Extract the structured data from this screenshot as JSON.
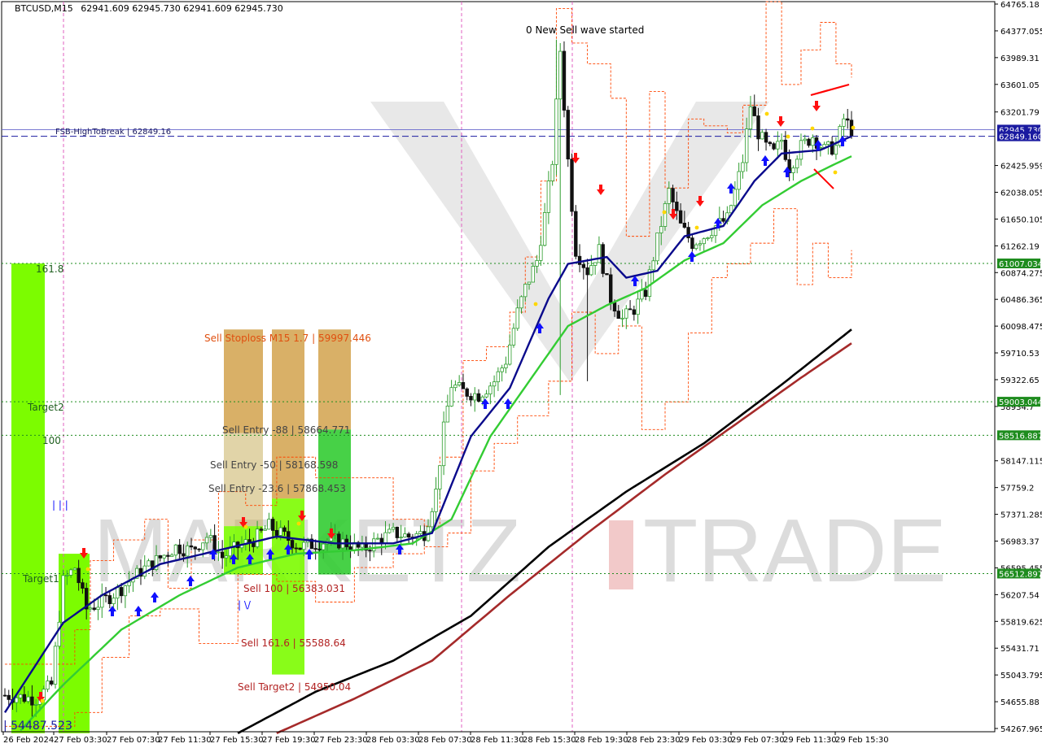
{
  "header": {
    "symbol": "BTCUSD,M15",
    "ohlc": "62941.609 62945.730 62941.609 62945.730"
  },
  "watermark": {
    "left": "MARKETZ",
    "right": "TRADE"
  },
  "colors": {
    "up_candle": "#2e9e2e",
    "down_candle": "#111111",
    "fast_ma": "#0a0a8c",
    "mid_ma": "#33cc33",
    "slow_ma_black": "#000000",
    "slow_ma_red": "#a52a2a",
    "orange": "#ff4500",
    "green_line": "#1e8c1e",
    "blue_level": "#1a1aa0"
  },
  "chart_data": {
    "type": "candlestick",
    "symbol": "BTCUSD",
    "timeframe": "M15",
    "ylim": [
      54200,
      64800
    ],
    "y_ticks": [
      64765.18,
      64377.055,
      63989.31,
      63601.05,
      63201.79,
      62425.959,
      62038.055,
      61650.105,
      61262.19,
      60874.275,
      60486.365,
      60098.475,
      59710.53,
      59322.65,
      58934.7,
      58147.115,
      57759.2,
      57371.285,
      56983.37,
      56595.455,
      56207.54,
      55819.625,
      55431.71,
      55043.795,
      54655.88,
      54267.965
    ],
    "x_ticks": [
      "26 Feb 2024",
      "27 Feb 03:30",
      "27 Feb 07:30",
      "27 Feb 11:30",
      "27 Feb 15:30",
      "27 Feb 19:30",
      "27 Feb 23:30",
      "28 Feb 03:30",
      "28 Feb 07:30",
      "28 Feb 11:30",
      "28 Feb 15:30",
      "28 Feb 19:30",
      "28 Feb 23:30",
      "29 Feb 03:30",
      "29 Feb 07:30",
      "29 Feb 11:30",
      "29 Feb 15:30"
    ],
    "current_price": "62945.730",
    "levels": [
      {
        "name": "FSB-HighToBreak",
        "value": 62849.16,
        "label": "FSB-HighToBreak | 62849.16",
        "badge": "62849.160",
        "style": "dashed",
        "color": "#1a1aa0"
      },
      {
        "name": "161.8",
        "value": 61007.034,
        "label": "161.8",
        "badge": "61007.034",
        "style": "dotted",
        "color": "#1e8c1e"
      },
      {
        "name": "Target2",
        "value": 59003.044,
        "label": "Target2",
        "badge": "59003.044",
        "style": "dotted",
        "color": "#1e8c1e"
      },
      {
        "name": "100",
        "value": 58516.887,
        "label": "100",
        "badge": "58516.887",
        "style": "dotted",
        "color": "#1e8c1e"
      },
      {
        "name": "Target1",
        "value": 56512.897,
        "label": "Target1",
        "badge": "56512.897",
        "style": "dotted",
        "color": "#1e8c1e"
      }
    ],
    "annotations": [
      {
        "text": "0 New Sell wave started",
        "color": "#000000"
      },
      {
        "text": "Sell Stoploss M15 1.7 | 59997.446",
        "color": "#e05010"
      },
      {
        "text": "Sell Entry -88 | 58664.771",
        "color": "#444444"
      },
      {
        "text": "Sell Entry -50 | 58168.598",
        "color": "#444444"
      },
      {
        "text": "Sell Entry -23.6 | 57868.453",
        "color": "#444444"
      },
      {
        "text": "Sell 100 | 56383.031",
        "color": "#b22222"
      },
      {
        "text": "Sell 161.6 | 55588.64",
        "color": "#b22222"
      },
      {
        "text": "Sell Target2 | 54950.04",
        "color": "#b22222"
      },
      {
        "text": "| 54487.523",
        "color": "#1a1aa0"
      }
    ],
    "candles_note": "Approximate price path: ~54.8k on 26 Feb, rising to ~56.8k by 27 Feb, consolidating ~57.0k, rallying to ~59.3k on 28 Feb 07:30, spike to ~64.2k on 28 Feb 15:30, pullback to ~60.2k, recovery to ~63.0k on 29 Feb, last 62945.73",
    "price_path": [
      [
        0,
        54750
      ],
      [
        8,
        54700
      ],
      [
        12,
        54900
      ],
      [
        15,
        56400
      ],
      [
        18,
        56600
      ],
      [
        21,
        56000
      ],
      [
        25,
        56100
      ],
      [
        30,
        56300
      ],
      [
        35,
        56550
      ],
      [
        39,
        56700
      ],
      [
        44,
        56900
      ],
      [
        48,
        56850
      ],
      [
        52,
        57050
      ],
      [
        56,
        56750
      ],
      [
        60,
        56900
      ],
      [
        64,
        57000
      ],
      [
        68,
        57200
      ],
      [
        72,
        57050
      ],
      [
        76,
        56900
      ],
      [
        80,
        56950
      ],
      [
        84,
        57000
      ],
      [
        88,
        56950
      ],
      [
        92,
        56850
      ],
      [
        96,
        57000
      ],
      [
        100,
        57100
      ],
      [
        104,
        57050
      ],
      [
        108,
        57100
      ],
      [
        111,
        57700
      ],
      [
        113,
        58600
      ],
      [
        115,
        59250
      ],
      [
        118,
        59150
      ],
      [
        122,
        59100
      ],
      [
        126,
        59300
      ],
      [
        129,
        59600
      ],
      [
        132,
        60300
      ],
      [
        134,
        60650
      ],
      [
        137,
        61050
      ],
      [
        139,
        61700
      ],
      [
        141,
        62500
      ],
      [
        143,
        64100
      ],
      [
        145,
        62500
      ],
      [
        147,
        61200
      ],
      [
        150,
        60900
      ],
      [
        153,
        61200
      ],
      [
        156,
        60500
      ],
      [
        159,
        60200
      ],
      [
        162,
        60350
      ],
      [
        165,
        60600
      ],
      [
        168,
        61350
      ],
      [
        171,
        62050
      ],
      [
        174,
        61550
      ],
      [
        177,
        61300
      ],
      [
        180,
        61400
      ],
      [
        183,
        61550
      ],
      [
        186,
        61650
      ],
      [
        188,
        62050
      ],
      [
        190,
        62500
      ],
      [
        192,
        63300
      ],
      [
        194,
        62900
      ],
      [
        196,
        62700
      ],
      [
        198,
        62600
      ],
      [
        200,
        62800
      ],
      [
        202,
        62400
      ],
      [
        205,
        62700
      ],
      [
        208,
        62850
      ],
      [
        211,
        62650
      ],
      [
        214,
        62700
      ],
      [
        216,
        63100
      ],
      [
        218,
        62950
      ]
    ],
    "ma_fast": [
      [
        0,
        54500
      ],
      [
        15,
        55800
      ],
      [
        25,
        56200
      ],
      [
        40,
        56650
      ],
      [
        55,
        56850
      ],
      [
        70,
        57050
      ],
      [
        85,
        56950
      ],
      [
        100,
        56950
      ],
      [
        110,
        57100
      ],
      [
        120,
        58500
      ],
      [
        130,
        59200
      ],
      [
        140,
        60500
      ],
      [
        145,
        61000
      ],
      [
        155,
        61100
      ],
      [
        160,
        60800
      ],
      [
        168,
        60900
      ],
      [
        175,
        61400
      ],
      [
        185,
        61550
      ],
      [
        193,
        62200
      ],
      [
        200,
        62600
      ],
      [
        210,
        62650
      ],
      [
        218,
        62850
      ]
    ],
    "ma_mid": [
      [
        0,
        54000
      ],
      [
        15,
        54900
      ],
      [
        30,
        55700
      ],
      [
        45,
        56200
      ],
      [
        60,
        56600
      ],
      [
        75,
        56800
      ],
      [
        90,
        56850
      ],
      [
        105,
        56950
      ],
      [
        115,
        57300
      ],
      [
        125,
        58500
      ],
      [
        135,
        59300
      ],
      [
        145,
        60100
      ],
      [
        155,
        60400
      ],
      [
        165,
        60650
      ],
      [
        175,
        61050
      ],
      [
        185,
        61300
      ],
      [
        195,
        61850
      ],
      [
        205,
        62200
      ],
      [
        212,
        62400
      ],
      [
        218,
        62560
      ]
    ],
    "ma_slow_black": [
      [
        60,
        54200
      ],
      [
        80,
        54800
      ],
      [
        100,
        55250
      ],
      [
        120,
        55900
      ],
      [
        140,
        56900
      ],
      [
        160,
        57700
      ],
      [
        180,
        58400
      ],
      [
        200,
        59250
      ],
      [
        218,
        60050
      ]
    ],
    "ma_slow_red": [
      [
        70,
        54200
      ],
      [
        90,
        54700
      ],
      [
        110,
        55250
      ],
      [
        130,
        56200
      ],
      [
        150,
        57100
      ],
      [
        170,
        57950
      ],
      [
        190,
        58750
      ],
      [
        205,
        59350
      ],
      [
        218,
        59850
      ]
    ]
  }
}
